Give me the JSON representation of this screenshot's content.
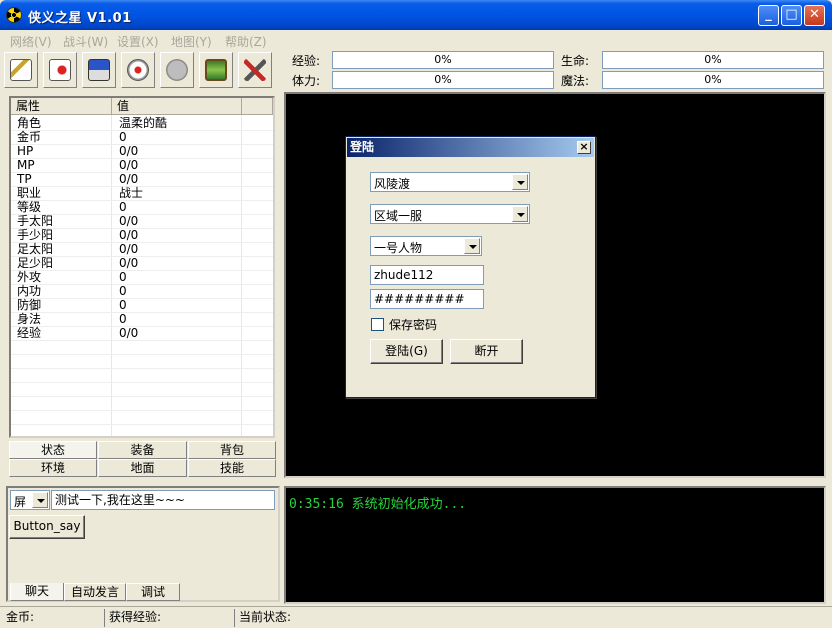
{
  "window": {
    "title": "侠义之星  V1.01",
    "min_glyph": "_",
    "max_glyph": "□",
    "close_glyph": "✕"
  },
  "menu": {
    "items": [
      "网络(V)",
      "战斗(W)",
      "设置(X)",
      "地图(Y)",
      "帮助(Z)"
    ]
  },
  "toolbar": {
    "icons": [
      "connect-icon",
      "battle-icon",
      "computer-icon",
      "skill-icon",
      "disabled-icon",
      "treasure-icon",
      "tools-icon"
    ]
  },
  "stats": {
    "exp_label": "经验:",
    "exp_value": "0%",
    "hp_label": "生命:",
    "hp_value": "0%",
    "stamina_label": "体力:",
    "stamina_value": "0%",
    "mana_label": "魔法:",
    "mana_value": "0%"
  },
  "properties": {
    "col_attr": "属性",
    "col_value": "值",
    "rows": [
      {
        "key": "角色",
        "value": "温柔的酷"
      },
      {
        "key": "金币",
        "value": "0"
      },
      {
        "key": "HP",
        "value": "0/0"
      },
      {
        "key": "MP",
        "value": "0/0"
      },
      {
        "key": "TP",
        "value": "0/0"
      },
      {
        "key": "职业",
        "value": "战士"
      },
      {
        "key": "等级",
        "value": "0"
      },
      {
        "key": "手太阳",
        "value": "0/0"
      },
      {
        "key": "手少阳",
        "value": "0/0"
      },
      {
        "key": "足太阳",
        "value": "0/0"
      },
      {
        "key": "足少阳",
        "value": "0/0"
      },
      {
        "key": "外攻",
        "value": "0"
      },
      {
        "key": "内功",
        "value": "0"
      },
      {
        "key": "防御",
        "value": "0"
      },
      {
        "key": "身法",
        "value": "0"
      },
      {
        "key": "经验",
        "value": "0/0"
      }
    ]
  },
  "tabs": {
    "status": "状态",
    "equipment": "装备",
    "backpack": "背包",
    "environment": "环境",
    "ground": "地面",
    "skills": "技能"
  },
  "chat": {
    "channel": "屏",
    "message": "测试一下,我在这里~~~",
    "say_button": "Button_say",
    "tab_chat": "聊天",
    "tab_auto": "自动发言",
    "tab_debug": "调试"
  },
  "log": {
    "line1": "0:35:16 系统初始化成功..."
  },
  "statusbar": {
    "gold": "金币:",
    "exp_gained": "获得经验:",
    "current_state": "当前状态:"
  },
  "login": {
    "title": "登陆",
    "server": "风陵渡",
    "zone": "区域一服",
    "character": "一号人物",
    "username": "zhude112",
    "password": "#########",
    "save_password": "保存密码",
    "login_button": "登陆(G)",
    "disconnect_button": "断开"
  }
}
